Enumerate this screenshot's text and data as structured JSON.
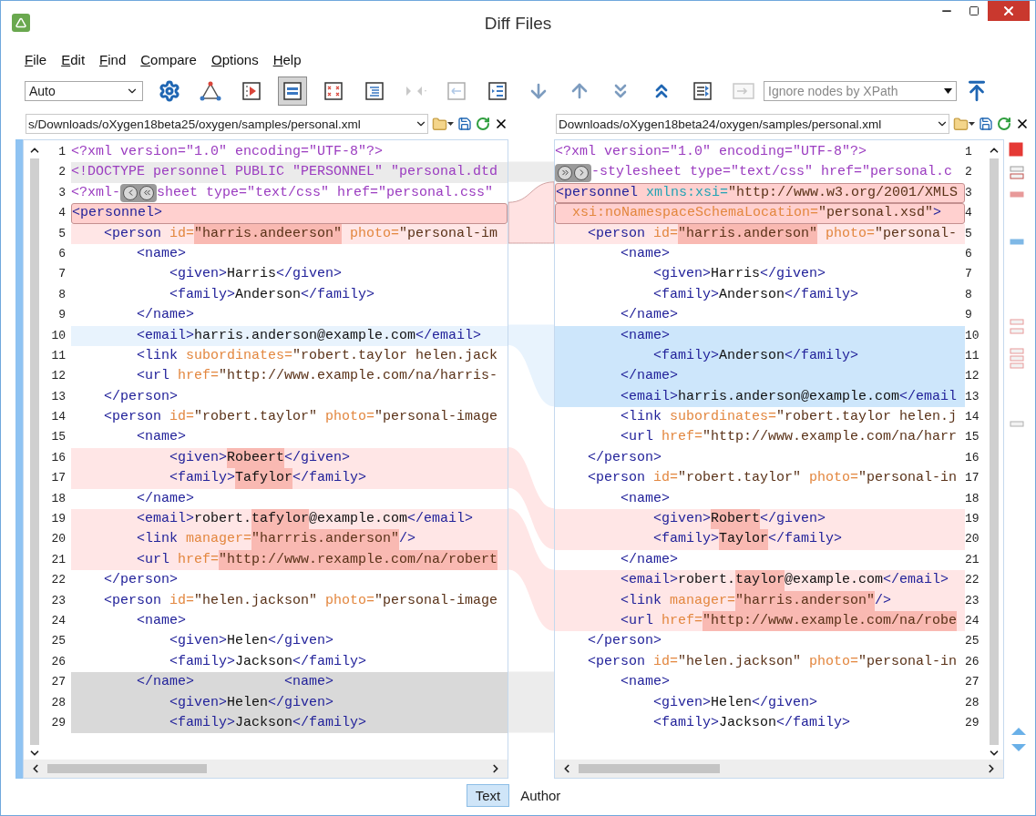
{
  "window": {
    "title": "Diff Files"
  },
  "menu": [
    "File",
    "Edit",
    "Find",
    "Compare",
    "Options",
    "Help"
  ],
  "toolbar": {
    "mode": "Auto",
    "xpath_placeholder": "Ignore nodes by XPath",
    "buttons": [
      {
        "kind": "settings",
        "pressed": false,
        "disabled": false
      },
      {
        "kind": "nodes",
        "pressed": false,
        "disabled": false
      },
      {
        "kind": "run",
        "pressed": false,
        "disabled": false
      },
      {
        "kind": "compare",
        "pressed": true,
        "disabled": false
      },
      {
        "kind": "grid",
        "pressed": false,
        "disabled": false
      },
      {
        "kind": "format",
        "pressed": false,
        "disabled": false
      },
      {
        "kind": "merge",
        "pressed": false,
        "disabled": true
      },
      {
        "kind": "copy-left",
        "pressed": false,
        "disabled": true
      },
      {
        "kind": "copy-all",
        "pressed": false,
        "disabled": false
      },
      {
        "kind": "next",
        "pressed": false,
        "disabled": false
      },
      {
        "kind": "previous",
        "pressed": false,
        "disabled": false
      },
      {
        "kind": "last",
        "pressed": false,
        "disabled": false
      },
      {
        "kind": "first",
        "pressed": false,
        "disabled": false
      },
      {
        "kind": "sync",
        "pressed": false,
        "disabled": false
      },
      {
        "kind": "apply",
        "pressed": false,
        "disabled": true
      }
    ]
  },
  "left": {
    "path": "s/Downloads/oXygen18beta25/oxygen/samples/personal.xml",
    "lines": [
      {
        "number": "1",
        "kind": "plain",
        "segments": [
          {
            "kind": "pi",
            "text": "<?xml version=\"1.0\" encoding=\"UTF-8\"?>"
          }
        ]
      },
      {
        "number": "2",
        "kind": "header",
        "segments": [
          {
            "kind": "pi",
            "text": "<!DOCTYPE personnel PUBLIC \"PERSONNEL\" \"personal.dtd"
          }
        ]
      },
      {
        "number": "3",
        "kind": "plain",
        "segments": [
          {
            "kind": "pi",
            "text": "<?xml-"
          },
          {
            "kind": "merge"
          },
          {
            "kind": "pi",
            "text": "sheet type=\"text/css\" href=\"personal.css\""
          }
        ]
      },
      {
        "number": "4",
        "kind": "boxed",
        "segments": [
          {
            "kind": "tag",
            "text": "<personnel>"
          }
        ]
      },
      {
        "number": "5",
        "kind": "changed",
        "segments": [
          {
            "kind": "tag",
            "text": "    <person"
          },
          {
            "kind": "attr",
            "text": " id="
          },
          {
            "kind": "value_changed",
            "text": "\"harris.andeerson\""
          },
          {
            "kind": "attr",
            "text": " photo="
          },
          {
            "kind": "value",
            "text": "\"personal-im"
          }
        ]
      },
      {
        "number": "6",
        "kind": "plain",
        "segments": [
          {
            "kind": "tag",
            "text": "        <name>"
          }
        ]
      },
      {
        "number": "7",
        "kind": "plain",
        "segments": [
          {
            "kind": "tag",
            "text": "            <given>"
          },
          {
            "kind": "text",
            "text": "Harris"
          },
          {
            "kind": "tag",
            "text": "</given>"
          }
        ]
      },
      {
        "number": "8",
        "kind": "plain",
        "segments": [
          {
            "kind": "tag",
            "text": "            <family>"
          },
          {
            "kind": "text",
            "text": "Anderson"
          },
          {
            "kind": "tag",
            "text": "</family>"
          }
        ]
      },
      {
        "number": "9",
        "kind": "plain",
        "segments": [
          {
            "kind": "tag",
            "text": "        </name>"
          }
        ]
      },
      {
        "number": "10",
        "kind": "selected",
        "segments": [
          {
            "kind": "tag",
            "text": "        <email>"
          },
          {
            "kind": "text",
            "text": "harris.anderson@example.com"
          },
          {
            "kind": "tag",
            "text": "</email>"
          }
        ]
      },
      {
        "number": "11",
        "kind": "plain",
        "segments": [
          {
            "kind": "tag",
            "text": "        <link"
          },
          {
            "kind": "attr",
            "text": " subordinates="
          },
          {
            "kind": "value",
            "text": "\"robert.taylor helen.jack"
          }
        ]
      },
      {
        "number": "12",
        "kind": "plain",
        "segments": [
          {
            "kind": "tag",
            "text": "        <url"
          },
          {
            "kind": "attr",
            "text": " href="
          },
          {
            "kind": "value",
            "text": "\"http://www.example.com/na/harris-"
          }
        ]
      },
      {
        "number": "13",
        "kind": "plain",
        "segments": [
          {
            "kind": "tag",
            "text": "    </person>"
          }
        ]
      },
      {
        "number": "14",
        "kind": "plain",
        "segments": [
          {
            "kind": "tag",
            "text": "    <person"
          },
          {
            "kind": "attr",
            "text": " id="
          },
          {
            "kind": "value",
            "text": "\"robert.taylor\""
          },
          {
            "kind": "attr",
            "text": " photo="
          },
          {
            "kind": "value",
            "text": "\"personal-image"
          }
        ]
      },
      {
        "number": "15",
        "kind": "plain",
        "segments": [
          {
            "kind": "tag",
            "text": "        <name>"
          }
        ]
      },
      {
        "number": "16",
        "kind": "changed",
        "segments": [
          {
            "kind": "tag",
            "text": "            <given>"
          },
          {
            "kind": "text_changed",
            "text": "Robeert"
          },
          {
            "kind": "tag",
            "text": "</given>"
          }
        ]
      },
      {
        "number": "17",
        "kind": "changed",
        "segments": [
          {
            "kind": "tag",
            "text": "            <family>"
          },
          {
            "kind": "text_changed",
            "text": "Tafylor"
          },
          {
            "kind": "tag",
            "text": "</family>"
          }
        ]
      },
      {
        "number": "18",
        "kind": "plain",
        "segments": [
          {
            "kind": "tag",
            "text": "        </name>"
          }
        ]
      },
      {
        "number": "19",
        "kind": "changed",
        "segments": [
          {
            "kind": "tag",
            "text": "        <email>"
          },
          {
            "kind": "text",
            "text": "robert."
          },
          {
            "kind": "text_changed",
            "text": "tafylor"
          },
          {
            "kind": "text",
            "text": "@example.com"
          },
          {
            "kind": "tag",
            "text": "</email>"
          }
        ]
      },
      {
        "number": "20",
        "kind": "changed",
        "segments": [
          {
            "kind": "tag",
            "text": "        <link"
          },
          {
            "kind": "attr",
            "text": " manager="
          },
          {
            "kind": "value_changed",
            "text": "\"harrris.anderson\""
          },
          {
            "kind": "tag",
            "text": "/>"
          }
        ]
      },
      {
        "number": "21",
        "kind": "changed",
        "segments": [
          {
            "kind": "tag",
            "text": "        <url"
          },
          {
            "kind": "attr",
            "text": " href="
          },
          {
            "kind": "value_changed",
            "text": "\"http://www.rexample.com/na/robert"
          }
        ]
      },
      {
        "number": "22",
        "kind": "plain",
        "segments": [
          {
            "kind": "tag",
            "text": "    </person>"
          }
        ]
      },
      {
        "number": "23",
        "kind": "plain",
        "segments": [
          {
            "kind": "tag",
            "text": "    <person"
          },
          {
            "kind": "attr",
            "text": " id="
          },
          {
            "kind": "value",
            "text": "\"helen.jackson\""
          },
          {
            "kind": "attr",
            "text": " photo="
          },
          {
            "kind": "value",
            "text": "\"personal-image"
          }
        ]
      },
      {
        "number": "24",
        "kind": "plain",
        "segments": [
          {
            "kind": "tag",
            "text": "        <name>"
          }
        ]
      },
      {
        "number": "25",
        "kind": "plain",
        "segments": [
          {
            "kind": "tag",
            "text": "            <given>"
          },
          {
            "kind": "text",
            "text": "Helen"
          },
          {
            "kind": "tag",
            "text": "</given>"
          }
        ]
      },
      {
        "number": "26",
        "kind": "plain",
        "segments": [
          {
            "kind": "tag",
            "text": "            <family>"
          },
          {
            "kind": "text",
            "text": "Jackson"
          },
          {
            "kind": "tag",
            "text": "</family>"
          }
        ]
      },
      {
        "number": "27",
        "kind": "ghost",
        "segments": [
          {
            "kind": "tag",
            "text": "        </name>           <name>"
          }
        ]
      },
      {
        "number": "28",
        "kind": "ghost",
        "segments": [
          {
            "kind": "tag",
            "text": "            <given>"
          },
          {
            "kind": "text",
            "text": "Helen"
          },
          {
            "kind": "tag",
            "text": "</given>"
          }
        ]
      },
      {
        "number": "29",
        "kind": "ghost",
        "segments": [
          {
            "kind": "tag",
            "text": "            <family>"
          },
          {
            "kind": "text",
            "text": "Jackson"
          },
          {
            "kind": "tag",
            "text": "</family>"
          }
        ]
      }
    ]
  },
  "right": {
    "path": "Downloads/oXygen18beta24/oxygen/samples/personal.xml",
    "lines": [
      {
        "number": "1",
        "kind": "plain",
        "segments": [
          {
            "kind": "pi",
            "text": "<?xml version=\"1.0\" encoding=\"UTF-8\"?>"
          }
        ]
      },
      {
        "number": "2",
        "kind": "plain",
        "segments": [
          {
            "kind": "merge"
          },
          {
            "kind": "pi",
            "text": "-stylesheet type=\"text/css\" href=\"personal.c"
          }
        ]
      },
      {
        "number": "3",
        "kind": "boxed",
        "segments": [
          {
            "kind": "tag",
            "text": "<personnel"
          },
          {
            "kind": "ns",
            "text": " xmlns:xsi="
          },
          {
            "kind": "value",
            "text": "\"http://www.w3.org/2001/XMLS"
          }
        ]
      },
      {
        "number": "4",
        "kind": "boxed",
        "segments": [
          {
            "kind": "attr",
            "text": "  xsi:noNamespaceSchemaLocation="
          },
          {
            "kind": "value",
            "text": "\"personal.xsd\""
          },
          {
            "kind": "tag",
            "text": ">"
          }
        ]
      },
      {
        "number": "5",
        "kind": "changed",
        "segments": [
          {
            "kind": "tag",
            "text": "    <person"
          },
          {
            "kind": "attr",
            "text": " id="
          },
          {
            "kind": "value_changed",
            "text": "\"harris.anderson\""
          },
          {
            "kind": "attr",
            "text": " photo="
          },
          {
            "kind": "value",
            "text": "\"personal-"
          }
        ]
      },
      {
        "number": "6",
        "kind": "plain",
        "segments": [
          {
            "kind": "tag",
            "text": "        <name>"
          }
        ]
      },
      {
        "number": "7",
        "kind": "plain",
        "segments": [
          {
            "kind": "tag",
            "text": "            <given>"
          },
          {
            "kind": "text",
            "text": "Harris"
          },
          {
            "kind": "tag",
            "text": "</given>"
          }
        ]
      },
      {
        "number": "8",
        "kind": "plain",
        "segments": [
          {
            "kind": "tag",
            "text": "            <family>"
          },
          {
            "kind": "text",
            "text": "Anderson"
          },
          {
            "kind": "tag",
            "text": "</family>"
          }
        ]
      },
      {
        "number": "9",
        "kind": "plain",
        "segments": [
          {
            "kind": "tag",
            "text": "        </name>"
          }
        ]
      },
      {
        "number": "10",
        "kind": "moved",
        "segments": [
          {
            "kind": "tag",
            "text": "        <name>"
          }
        ]
      },
      {
        "number": "11",
        "kind": "moved",
        "segments": [
          {
            "kind": "tag",
            "text": "            <family>"
          },
          {
            "kind": "text",
            "text": "Anderson"
          },
          {
            "kind": "tag",
            "text": "</family>"
          }
        ]
      },
      {
        "number": "12",
        "kind": "moved",
        "segments": [
          {
            "kind": "tag",
            "text": "        </name>"
          }
        ]
      },
      {
        "number": "13",
        "kind": "moved",
        "segments": [
          {
            "kind": "tag",
            "text": "        <email>"
          },
          {
            "kind": "text",
            "text": "harris.anderson@example.com"
          },
          {
            "kind": "tag",
            "text": "</email"
          }
        ]
      },
      {
        "number": "14",
        "kind": "plain",
        "segments": [
          {
            "kind": "tag",
            "text": "        <link"
          },
          {
            "kind": "attr",
            "text": " subordinates="
          },
          {
            "kind": "value",
            "text": "\"robert.taylor helen.j"
          }
        ]
      },
      {
        "number": "15",
        "kind": "plain",
        "segments": [
          {
            "kind": "tag",
            "text": "        <url"
          },
          {
            "kind": "attr",
            "text": " href="
          },
          {
            "kind": "value",
            "text": "\"http://www.example.com/na/harr"
          }
        ]
      },
      {
        "number": "16",
        "kind": "plain",
        "segments": [
          {
            "kind": "tag",
            "text": "    </person>"
          }
        ]
      },
      {
        "number": "17",
        "kind": "plain",
        "segments": [
          {
            "kind": "tag",
            "text": "    <person"
          },
          {
            "kind": "attr",
            "text": " id="
          },
          {
            "kind": "value",
            "text": "\"robert.taylor\""
          },
          {
            "kind": "attr",
            "text": " photo="
          },
          {
            "kind": "value",
            "text": "\"personal-in"
          }
        ]
      },
      {
        "number": "18",
        "kind": "plain",
        "segments": [
          {
            "kind": "tag",
            "text": "        <name>"
          }
        ]
      },
      {
        "number": "19",
        "kind": "changed",
        "segments": [
          {
            "kind": "tag",
            "text": "            <given>"
          },
          {
            "kind": "text_changed",
            "text": "Robert"
          },
          {
            "kind": "tag",
            "text": "</given>"
          }
        ]
      },
      {
        "number": "20",
        "kind": "changed",
        "segments": [
          {
            "kind": "tag",
            "text": "            <family>"
          },
          {
            "kind": "text_changed",
            "text": "Taylor"
          },
          {
            "kind": "tag",
            "text": "</family>"
          }
        ]
      },
      {
        "number": "21",
        "kind": "plain",
        "segments": [
          {
            "kind": "tag",
            "text": "        </name>"
          }
        ]
      },
      {
        "number": "22",
        "kind": "changed",
        "segments": [
          {
            "kind": "tag",
            "text": "        <email>"
          },
          {
            "kind": "text",
            "text": "robert."
          },
          {
            "kind": "text_changed",
            "text": "taylor"
          },
          {
            "kind": "text",
            "text": "@example.com"
          },
          {
            "kind": "tag",
            "text": "</email>"
          }
        ]
      },
      {
        "number": "23",
        "kind": "changed",
        "segments": [
          {
            "kind": "tag",
            "text": "        <link"
          },
          {
            "kind": "attr",
            "text": " manager="
          },
          {
            "kind": "value_changed",
            "text": "\"harris.anderson\""
          },
          {
            "kind": "tag",
            "text": "/>"
          }
        ]
      },
      {
        "number": "24",
        "kind": "changed",
        "segments": [
          {
            "kind": "tag",
            "text": "        <url"
          },
          {
            "kind": "attr",
            "text": " href="
          },
          {
            "kind": "value_changed",
            "text": "\"http://www.example.com/na/robe"
          }
        ]
      },
      {
        "number": "25",
        "kind": "plain",
        "segments": [
          {
            "kind": "tag",
            "text": "    </person>"
          }
        ]
      },
      {
        "number": "26",
        "kind": "plain",
        "segments": [
          {
            "kind": "tag",
            "text": "    <person"
          },
          {
            "kind": "attr",
            "text": " id="
          },
          {
            "kind": "value",
            "text": "\"helen.jackson\""
          },
          {
            "kind": "attr",
            "text": " photo="
          },
          {
            "kind": "value",
            "text": "\"personal-in"
          }
        ]
      },
      {
        "number": "27",
        "kind": "plain",
        "segments": [
          {
            "kind": "tag",
            "text": "        <name>"
          }
        ]
      },
      {
        "number": "28",
        "kind": "plain",
        "segments": [
          {
            "kind": "tag",
            "text": "            <given>"
          },
          {
            "kind": "text",
            "text": "Helen"
          },
          {
            "kind": "tag",
            "text": "</given>"
          }
        ]
      },
      {
        "number": "29",
        "kind": "plain",
        "segments": [
          {
            "kind": "tag",
            "text": "            <family>"
          },
          {
            "kind": "text",
            "text": "Jackson"
          },
          {
            "kind": "tag",
            "text": "</family>"
          }
        ]
      }
    ]
  },
  "view_tabs": [
    {
      "label": "Text",
      "selected": true
    },
    {
      "label": "Author",
      "selected": false
    }
  ]
}
